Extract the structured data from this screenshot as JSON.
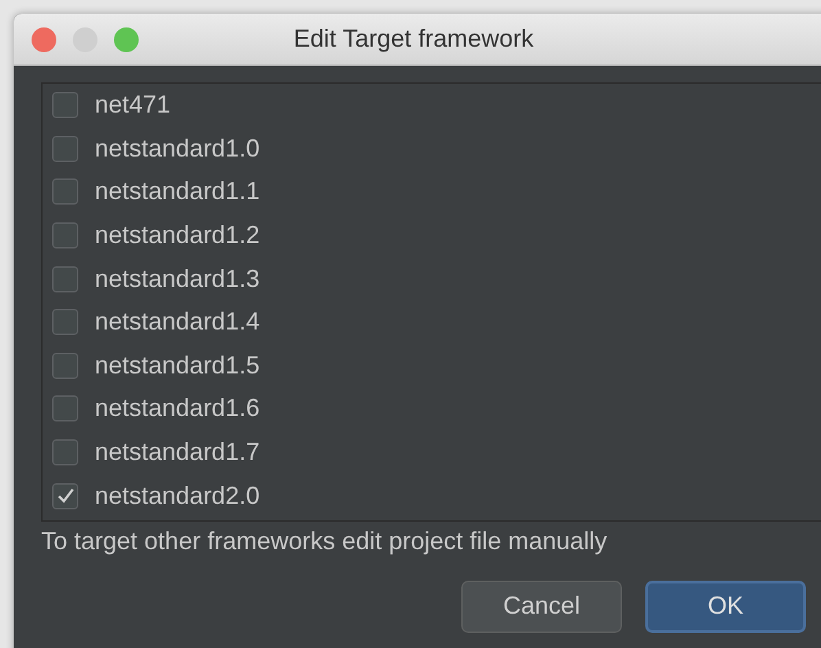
{
  "window": {
    "title": "Edit Target framework"
  },
  "frameworks": [
    {
      "label": "net471",
      "checked": false
    },
    {
      "label": "netstandard1.0",
      "checked": false
    },
    {
      "label": "netstandard1.1",
      "checked": false
    },
    {
      "label": "netstandard1.2",
      "checked": false
    },
    {
      "label": "netstandard1.3",
      "checked": false
    },
    {
      "label": "netstandard1.4",
      "checked": false
    },
    {
      "label": "netstandard1.5",
      "checked": false
    },
    {
      "label": "netstandard1.6",
      "checked": false
    },
    {
      "label": "netstandard1.7",
      "checked": false
    },
    {
      "label": "netstandard2.0",
      "checked": true
    }
  ],
  "hint": "To target other frameworks edit project file manually",
  "buttons": [
    {
      "label": "Cancel",
      "kind": "secondary"
    },
    {
      "label": "OK",
      "kind": "default"
    }
  ]
}
